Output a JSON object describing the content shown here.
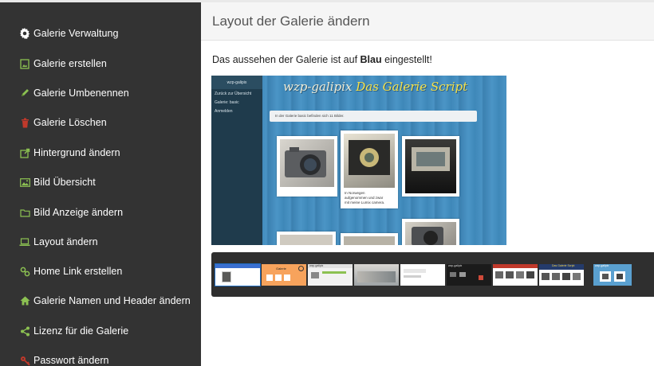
{
  "sidebar": {
    "items": [
      {
        "label": "Galerie Verwaltung",
        "icon": "gear-icon"
      },
      {
        "label": "Galerie erstellen",
        "icon": "image-file-icon"
      },
      {
        "label": "Galerie Umbenennen",
        "icon": "pencil-icon"
      },
      {
        "label": "Galerie Löschen",
        "icon": "trash-icon"
      },
      {
        "label": "Hintergrund ändern",
        "icon": "external-edit-icon"
      },
      {
        "label": "Bild Übersicht",
        "icon": "picture-icon"
      },
      {
        "label": "Bild Anzeige ändern",
        "icon": "folder-icon"
      },
      {
        "label": "Layout ändern",
        "icon": "laptop-icon"
      },
      {
        "label": "Home Link erstellen",
        "icon": "link-icon"
      },
      {
        "label": "Galerie Namen und Header ändern",
        "icon": "home-icon"
      },
      {
        "label": "Lizenz für die Galerie",
        "icon": "share-icon"
      },
      {
        "label": "Passwort ändern",
        "icon": "key-icon"
      }
    ]
  },
  "header": {
    "title": "Layout der Galerie ändern"
  },
  "info": {
    "prefix": "Das aussehen der Galerie ist auf ",
    "value": "Blau",
    "suffix": " eingestellt!"
  },
  "preview": {
    "sidebar_title": "wzp-galipix",
    "sidebar_links": [
      "Zurück zur Übersicht",
      "Galerie: basic",
      "Anmelden"
    ],
    "banner_left": "wzp-galipix",
    "banner_right": "Das Galerie Script",
    "alert": "In der Galerie basic befinden sich 11 Bilder.",
    "caption": [
      "In Norwegen",
      "aufgenommen und zwar",
      "mit meine Lumix camera."
    ]
  },
  "strip": {
    "thumbs": [
      {
        "name": "thumb-layout-white",
        "label": "",
        "bar": "#3a6fd0",
        "bg": "#ffffff"
      },
      {
        "name": "thumb-layout-orange",
        "label": "Galerie",
        "bar": "#f39c53",
        "bg": "#f7a35c"
      },
      {
        "name": "thumb-layout-light",
        "label": "wzp-galipix",
        "bar": "#8cc152",
        "bg": "#f2f2f2"
      },
      {
        "name": "thumb-layout-photo",
        "label": "",
        "bar": "#9aa3a8",
        "bg": "#c4c2bd"
      },
      {
        "name": "thumb-layout-minimal",
        "label": "",
        "bar": "#eeeeee",
        "bg": "#ffffff"
      },
      {
        "name": "thumb-layout-dark",
        "label": "wzp-galipix",
        "bar": "#111111",
        "bg": "#1b1b1b"
      },
      {
        "name": "thumb-layout-red",
        "label": "",
        "bar": "#c0392b",
        "bg": "#ffffff"
      },
      {
        "name": "thumb-layout-navy",
        "label": "Das Galerie Script",
        "bar": "#243b6b",
        "bg": "#ffffff"
      },
      {
        "name": "thumb-layout-blue",
        "label": "wzp-galipix",
        "bar": "#4a93c4",
        "bg": "#5aa0d0"
      }
    ]
  },
  "colors": {
    "sidebar_bg": "#333333",
    "header_bg": "#f5f5f5",
    "strip_bg": "#2f2f2f"
  }
}
